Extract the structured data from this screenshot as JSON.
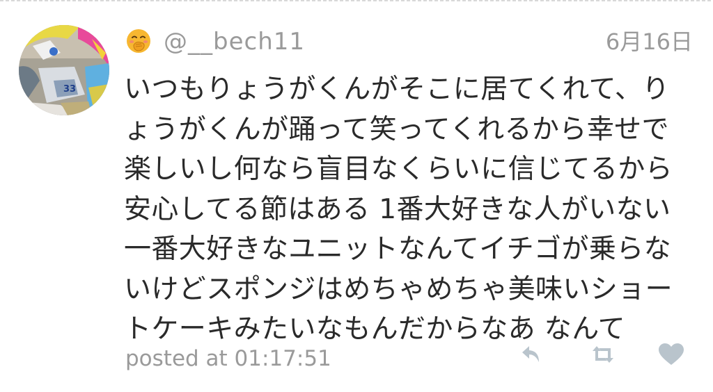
{
  "tweet": {
    "username": "@__bech11",
    "date": "6月16日",
    "emoji": "face-with-hand-over-mouth-icon",
    "body_lines": [
      "いつもりょうがくんがそこに居てくれて、り",
      "ょうがくんが踊って笑ってくれるから幸せで",
      "楽しいし何なら盲目なくらいに信じてるから",
      "安心してる節はある 1番大好きな人がいない",
      "一番大好きなユニットなんてイチゴが乗らな",
      "いけどスポンジはめちゃめちゃ美味いショー",
      "トケーキみたいなもんだからなあ なんて"
    ],
    "posted_at": "posted at 01:17:51"
  },
  "actions": {
    "reply_icon": "reply-icon",
    "retweet_icon": "retweet-icon",
    "like_icon": "heart-icon"
  },
  "colors": {
    "muted_text": "#9a9a9a",
    "body_text": "#2a2a2a",
    "icon": "#b9c4cc",
    "divider": "#d8d8d8"
  }
}
